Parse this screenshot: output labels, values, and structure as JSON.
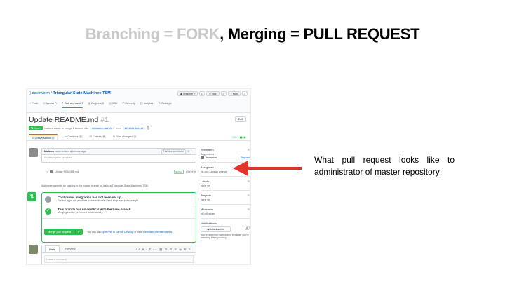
{
  "slide": {
    "title_part1": "Branching = FORK",
    "title_part2": ", Merging = PULL REQUEST",
    "annotation": "What pull request looks like to administrator of master repository."
  },
  "colors": {
    "accent_green": "#2cbe4e",
    "link_blue": "#0366d6",
    "arrow_red": "#e2332b"
  },
  "repo": {
    "owner": "devoworm",
    "name": "Triangular-State-Machines-TSM",
    "actions": [
      {
        "label": "Unwatch",
        "count": "1"
      },
      {
        "label": "Star",
        "count": "0"
      },
      {
        "label": "Fork",
        "count": "1"
      }
    ],
    "tabs": [
      {
        "label": "Code",
        "icon": "code-icon"
      },
      {
        "label": "Issues 0",
        "icon": "issue-icon"
      },
      {
        "label": "Pull requests 1",
        "icon": "pull-request-icon"
      },
      {
        "label": "Projects 0",
        "icon": "project-icon"
      },
      {
        "label": "Wiki",
        "icon": "wiki-icon"
      },
      {
        "label": "Security",
        "icon": "shield-icon"
      },
      {
        "label": "Insights",
        "icon": "graph-icon"
      },
      {
        "label": "Settings",
        "icon": "gear-icon"
      }
    ]
  },
  "pr": {
    "title": "Update README.md",
    "number": "#1",
    "edit": "Edit",
    "state": "Open",
    "meta": "balicea wants to merge 1 commit into",
    "base_branch": "devoworm:master",
    "from": "from",
    "head_branch": "balicea:master",
    "tabs": [
      {
        "label": "Conversation",
        "count": "0"
      },
      {
        "label": "Commits",
        "count": "1"
      },
      {
        "label": "Checks",
        "count": "0"
      },
      {
        "label": "Files changed",
        "count": "1"
      }
    ],
    "diffstat": "+20 −1"
  },
  "timeline": {
    "comment_author": "balicea",
    "comment_time": "commented a minute ago",
    "first_time_label": "First-time contributor",
    "comment_body": "No description provided.",
    "commit_message": "Update README.md",
    "verified": "Verified",
    "commit_sha": "a5e9f0f",
    "push_hint": "Add more commits by pushing to the master branch on balicea/Triangular-State-Machines-TSM."
  },
  "merge": {
    "ci_title": "Continuous integration has not been set up",
    "ci_sub": "Several apps are available to automatically catch bugs and enforce style.",
    "ok_title": "This branch has no conflicts with the base branch",
    "ok_sub": "Merging can be performed automatically.",
    "button": "Merge pull request",
    "hint_prefix": "You can also",
    "hint_link1": "open this in GitHub Desktop",
    "hint_mid": "or view",
    "hint_link2": "command line instructions."
  },
  "editor": {
    "tab_write": "Write",
    "tab_preview": "Preview",
    "tools": "AA B I  ❝ <> ⛓  ☰ ☰ ☰  @ ⊞ ↰",
    "placeholder": "Leave a comment"
  },
  "sidebar": {
    "reviewers_head": "Reviewers",
    "reviewers_sub": "Suggestions",
    "reviewer_name": "devoworm",
    "request": "Request",
    "assignees_head": "Assignees",
    "assignees_val": "No one—assign yourself",
    "labels_head": "Labels",
    "labels_val": "None yet",
    "projects_head": "Projects",
    "projects_val": "None yet",
    "milestone_head": "Milestone",
    "milestone_val": "No milestone",
    "notifications_head": "Notifications",
    "unsubscribe": "Unsubscribe",
    "notif_val": "You're receiving notifications because you're watching this repository."
  }
}
